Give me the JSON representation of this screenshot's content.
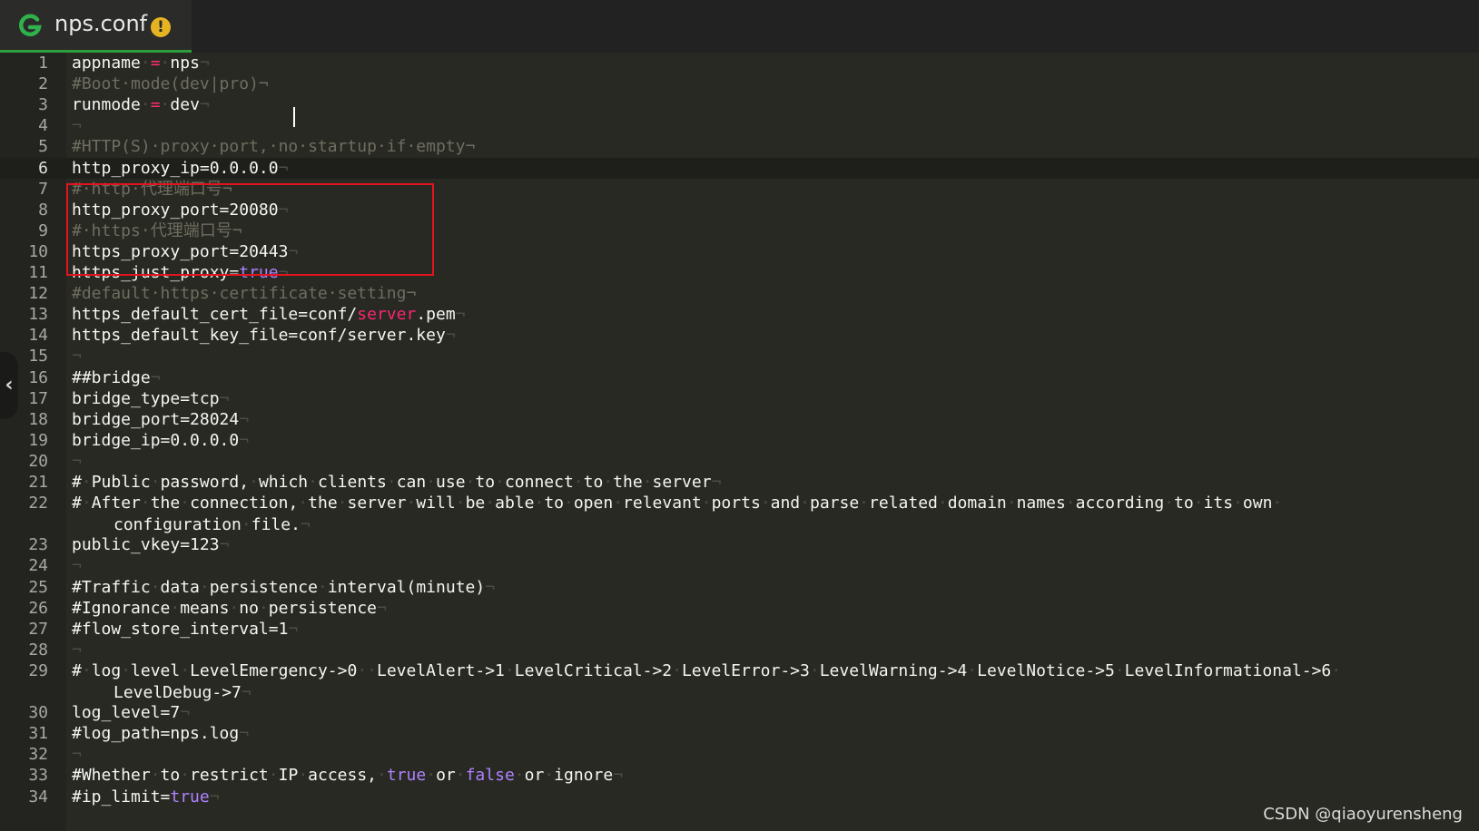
{
  "tab": {
    "title": "nps.conf",
    "warning_glyph": "!",
    "app_icon": "gitee-g-icon",
    "accent": "#2e9e3c",
    "warning_color": "#e6b422"
  },
  "editor": {
    "current_line": 6,
    "lines": [
      {
        "n": "1",
        "html": "appname<span class=\"ws\">·</span><span class=\"op\">=</span><span class=\"ws\">·</span>nps<span class=\"ws\">¬</span>"
      },
      {
        "n": "2",
        "html": "<span class=\"cm\">#Boot·mode(dev|pro)¬</span>"
      },
      {
        "n": "3",
        "html": "runmode<span class=\"ws\">·</span><span class=\"op\">=</span><span class=\"ws\">·</span>dev<span class=\"ws\">¬</span>"
      },
      {
        "n": "4",
        "html": "<span class=\"ws\">¬</span>"
      },
      {
        "n": "5",
        "html": "<span class=\"cm\">#HTTP(S)·proxy·port,·no·startup·if·empty¬</span>"
      },
      {
        "n": "6",
        "html": "http_proxy_ip=0.0.0.0<span class=\"ws\">¬</span>"
      },
      {
        "n": "7",
        "html": "<span class=\"cm\">#·http·代理端口号¬</span>"
      },
      {
        "n": "8",
        "html": "http_proxy_port=20080<span class=\"ws\">¬</span>"
      },
      {
        "n": "9",
        "html": "<span class=\"cm\">#·https·代理端口号¬</span>"
      },
      {
        "n": "10",
        "html": "https_proxy_port=20443<span class=\"ws\">¬</span>"
      },
      {
        "n": "11",
        "html": "https_just_proxy=<span class=\"bool\">true</span><span class=\"ws\">¬</span>"
      },
      {
        "n": "12",
        "html": "<span class=\"cm\">#default·https·certificate·setting¬</span>"
      },
      {
        "n": "13",
        "html": "https_default_cert_file=conf/<span class=\"str\">server</span>.pem<span class=\"ws\">¬</span>"
      },
      {
        "n": "14",
        "html": "https_default_key_file=conf/server.key<span class=\"ws\">¬</span>"
      },
      {
        "n": "15",
        "html": "<span class=\"ws\">¬</span>"
      },
      {
        "n": "16",
        "html": "##bridge<span class=\"ws\">¬</span>"
      },
      {
        "n": "17",
        "html": "bridge_type=tcp<span class=\"ws\">¬</span>"
      },
      {
        "n": "18",
        "html": "bridge_port=28024<span class=\"ws\">¬</span>"
      },
      {
        "n": "19",
        "html": "bridge_ip=0.0.0.0<span class=\"ws\">¬</span>"
      },
      {
        "n": "20",
        "html": "<span class=\"ws\">¬</span>"
      },
      {
        "n": "21",
        "html": "#<span class=\"ws\">·</span>Public<span class=\"ws\">·</span>password,<span class=\"ws\">·</span>which<span class=\"ws\">·</span>clients<span class=\"ws\">·</span>can<span class=\"ws\">·</span>use<span class=\"ws\">·</span>to<span class=\"ws\">·</span>connect<span class=\"ws\">·</span>to<span class=\"ws\">·</span>the<span class=\"ws\">·</span>server<span class=\"ws\">¬</span>"
      },
      {
        "n": "22",
        "html": "#<span class=\"ws\">·</span>After<span class=\"ws\">·</span>the<span class=\"ws\">·</span>connection,<span class=\"ws\">·</span>the<span class=\"ws\">·</span>server<span class=\"ws\">·</span>will<span class=\"ws\">·</span>be<span class=\"ws\">·</span>able<span class=\"ws\">·</span>to<span class=\"ws\">·</span>open<span class=\"ws\">·</span>relevant<span class=\"ws\">·</span>ports<span class=\"ws\">·</span>and<span class=\"ws\">·</span>parse<span class=\"ws\">·</span>related<span class=\"ws\">·</span>domain<span class=\"ws\">·</span>names<span class=\"ws\">·</span>according<span class=\"ws\">·</span>to<span class=\"ws\">·</span>its<span class=\"ws\">·</span>own<span class=\"ws\">·</span>",
        "cont": "configuration<span class=\"ws\">·</span>file.<span class=\"ws\">¬</span>"
      },
      {
        "n": "23",
        "html": "public_vkey=123<span class=\"ws\">¬</span>"
      },
      {
        "n": "24",
        "html": "<span class=\"ws\">¬</span>"
      },
      {
        "n": "25",
        "html": "#Traffic<span class=\"ws\">·</span>data<span class=\"ws\">·</span>persistence<span class=\"ws\">·</span>interval(minute)<span class=\"ws\">¬</span>"
      },
      {
        "n": "26",
        "html": "#Ignorance<span class=\"ws\">·</span>means<span class=\"ws\">·</span>no<span class=\"ws\">·</span>persistence<span class=\"ws\">¬</span>"
      },
      {
        "n": "27",
        "html": "#flow_store_interval=1<span class=\"ws\">¬</span>"
      },
      {
        "n": "28",
        "html": "<span class=\"ws\">¬</span>"
      },
      {
        "n": "29",
        "html": "#<span class=\"ws\">·</span>log<span class=\"ws\">·</span>level<span class=\"ws\">·</span>LevelEmergency-&gt;0<span class=\"ws\">··</span>LevelAlert-&gt;1<span class=\"ws\">·</span>LevelCritical-&gt;2<span class=\"ws\">·</span>LevelError-&gt;3<span class=\"ws\">·</span>LevelWarning-&gt;4<span class=\"ws\">·</span>LevelNotice-&gt;5<span class=\"ws\">·</span>LevelInformational-&gt;6<span class=\"ws\">·</span>",
        "cont": "LevelDebug-&gt;7<span class=\"ws\">¬</span>"
      },
      {
        "n": "30",
        "html": "log_level=7<span class=\"ws\">¬</span>"
      },
      {
        "n": "31",
        "html": "#log_path=nps.log<span class=\"ws\">¬</span>"
      },
      {
        "n": "32",
        "html": "<span class=\"ws\">¬</span>"
      },
      {
        "n": "33",
        "html": "#Whether<span class=\"ws\">·</span>to<span class=\"ws\">·</span>restrict<span class=\"ws\">·</span>IP<span class=\"ws\">·</span>access,<span class=\"ws\">·</span><span class=\"bool\">true</span><span class=\"ws\">·</span>or<span class=\"ws\">·</span><span class=\"bool\">false</span><span class=\"ws\">·</span>or<span class=\"ws\">·</span>ignore<span class=\"ws\">¬</span>"
      },
      {
        "n": "34",
        "html": "#ip_limit=<span class=\"bool\">true</span><span class=\"ws\">¬</span>"
      }
    ]
  },
  "collapse_glyph": "‹",
  "watermark": "CSDN @qiaoyurensheng"
}
